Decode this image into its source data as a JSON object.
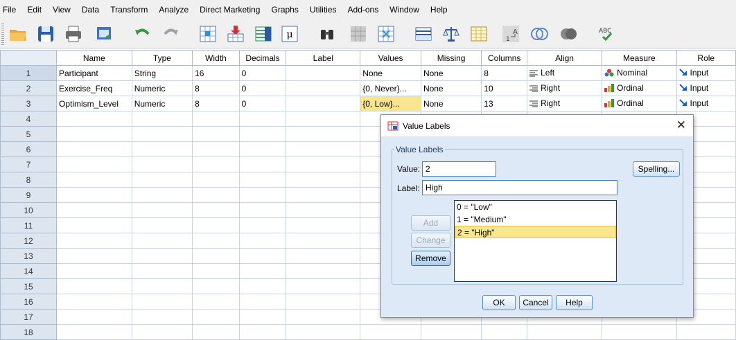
{
  "menu": [
    "File",
    "Edit",
    "View",
    "Data",
    "Transform",
    "Analyze",
    "Direct Marketing",
    "Graphs",
    "Utilities",
    "Add-ons",
    "Window",
    "Help"
  ],
  "toolbar": {
    "icons": [
      "open-folder-icon",
      "save-icon",
      "print-icon",
      "dialog-recall-icon",
      "undo-icon",
      "redo-icon",
      "goto-case-icon",
      "goto-variable-icon",
      "variables-icon",
      "descriptive-stats-icon",
      "find-icon",
      "insert-cases-icon",
      "insert-variable-icon",
      "split-file-icon",
      "weight-cases-icon",
      "select-cases-icon",
      "value-labels-icon",
      "use-sets-icon",
      "show-all-variables-icon",
      "spelling-icon"
    ],
    "spelling_glyph": "ABC"
  },
  "grid": {
    "columns": [
      "Name",
      "Type",
      "Width",
      "Decimals",
      "Label",
      "Values",
      "Missing",
      "Columns",
      "Align",
      "Measure",
      "Role"
    ],
    "row_numbers": [
      "1",
      "2",
      "3",
      "4",
      "5",
      "6",
      "7",
      "8",
      "9",
      "10",
      "11",
      "12",
      "13",
      "14",
      "15",
      "16",
      "17",
      "18"
    ],
    "rows": [
      {
        "name": "Participant",
        "type": "String",
        "width": "16",
        "decimals": "0",
        "label": "",
        "values": "None",
        "missing": "None",
        "columns": "8",
        "align": "Left",
        "measure": "Nominal",
        "role": "Input"
      },
      {
        "name": "Exercise_Freq",
        "type": "Numeric",
        "width": "8",
        "decimals": "0",
        "label": "",
        "values": "{0, Never}...",
        "missing": "None",
        "columns": "10",
        "align": "Right",
        "measure": "Ordinal",
        "role": "Input"
      },
      {
        "name": "Optimism_Level",
        "type": "Numeric",
        "width": "8",
        "decimals": "0",
        "label": "",
        "values": "{0, Low}...",
        "missing": "None",
        "columns": "13",
        "align": "Right",
        "measure": "Ordinal",
        "role": "Input"
      }
    ]
  },
  "dialog": {
    "title": "Value Labels",
    "group_label": "Value Labels",
    "value_label": "Value:",
    "value": "2",
    "label_label": "Label:",
    "label": "High",
    "spelling_button": "Spelling...",
    "add_button": "Add",
    "change_button": "Change",
    "remove_button": "Remove",
    "list": [
      "0 = \"Low\"",
      "1 = \"Medium\"",
      "2 = \"High\""
    ],
    "selected_index": 2,
    "ok_button": "OK",
    "cancel_button": "Cancel",
    "help_button": "Help"
  },
  "colors": {
    "selection": "#f8e58e",
    "dialog_bg": "#dde9f6",
    "row_header": "#dde6f0"
  }
}
